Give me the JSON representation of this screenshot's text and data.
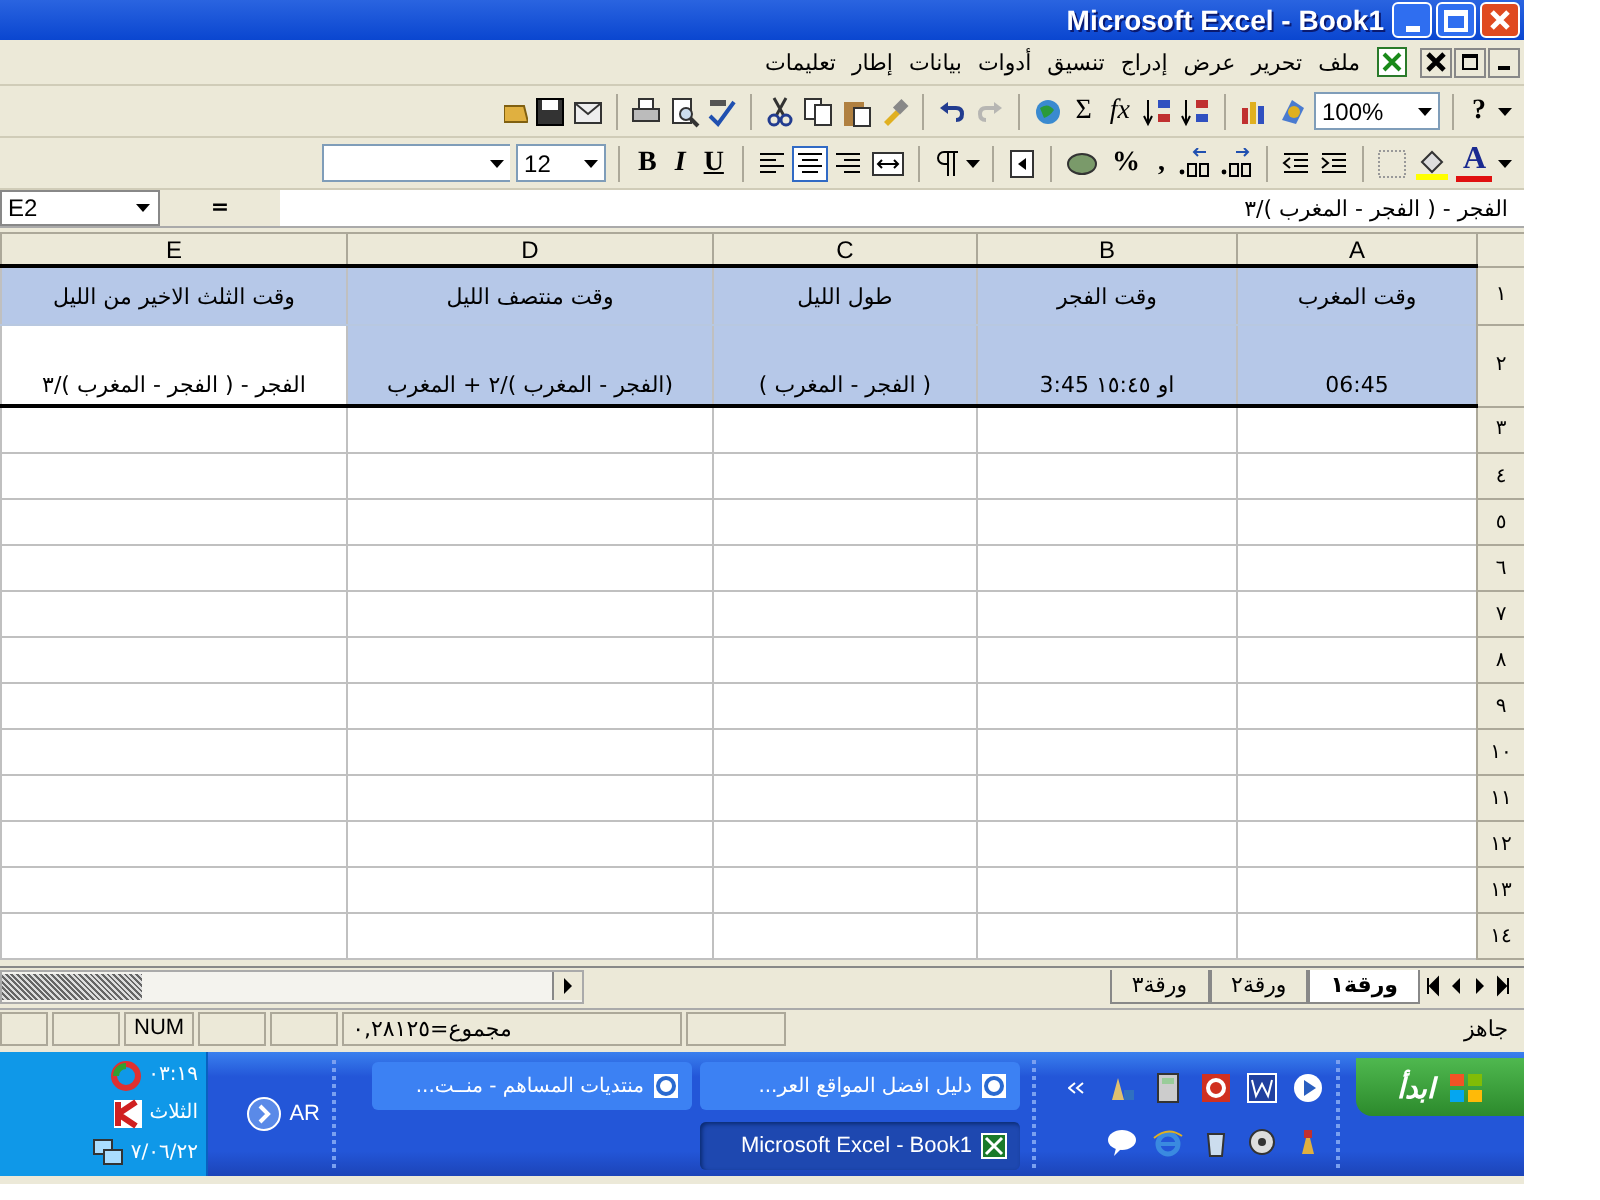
{
  "window": {
    "title": "Microsoft Excel - Book1"
  },
  "menu": {
    "items": [
      "ملف",
      "تحرير",
      "عرض",
      "إدراج",
      "تنسيق",
      "أدوات",
      "بيانات",
      "إطار",
      "تعليمات"
    ]
  },
  "standard_toolbar": {
    "sum": "Σ",
    "function": "fx",
    "zoom": "100%",
    "help": "?"
  },
  "format_toolbar": {
    "font_size": "12",
    "bold": "B",
    "italic": "I",
    "underline": "U",
    "alignment_buttons": [
      {
        "selected": false
      },
      {
        "selected": true
      },
      {
        "selected": false
      }
    ],
    "percent": "%",
    "comma": ",",
    "font_color": "A"
  },
  "formula_bar": {
    "name_box": "E2",
    "equals": "=",
    "formula": "الفجر - ( الفجر - المغرب )/٣"
  },
  "columns": [
    "A",
    "B",
    "C",
    "D",
    "E"
  ],
  "rows": [
    {
      "header": "١",
      "cells": [
        {
          "text": "وقت المغرب",
          "selected": true
        },
        {
          "text": "وقت الفجر",
          "selected": true
        },
        {
          "text": "طول الليل",
          "selected": true
        },
        {
          "text": "وقت منتصف الليل",
          "selected": true
        },
        {
          "text": "وقت الثلث الاخير من الليل",
          "selected": true
        }
      ]
    },
    {
      "header": "٢",
      "cells": [
        {
          "text": "06:45",
          "selected": true
        },
        {
          "text": "او   ١٥:٤٥   3:45",
          "selected": true
        },
        {
          "text": "( الفجر - المغرب )",
          "selected": true
        },
        {
          "text": "(الفجر - المغرب )/٢ + المغرب",
          "selected": true
        },
        {
          "text": "الفجر - ( الفجر - المغرب )/٣",
          "selected": false
        }
      ]
    }
  ],
  "empty_rows": [
    "٣",
    "٤",
    "٥",
    "٦",
    "٧",
    "٨",
    "٩",
    "١٠",
    "١١",
    "١٢",
    "١٣",
    "١٤"
  ],
  "sheet_tabs": [
    {
      "label": "ورقة١",
      "selected": true
    },
    {
      "label": "ورقة٢",
      "selected": false
    },
    {
      "label": "ورقة٣",
      "selected": false
    }
  ],
  "status_bar": {
    "status": "جاهز",
    "sum": "مجموع=٠,٢٨١٢٥",
    "num": "NUM"
  },
  "taskbar": {
    "start": "ابدأ",
    "tasks": [
      {
        "label": "دليل افضل المواقع العر...",
        "selected": false
      },
      {
        "label": "منتديات المساهم - منــت...",
        "selected": false
      },
      {
        "label": "Microsoft Excel - Book1",
        "selected": true
      }
    ],
    "language": "AR",
    "clock": [
      "٠٣:١٩",
      "الثلاث",
      "٧/٠٦/٢٢"
    ]
  }
}
